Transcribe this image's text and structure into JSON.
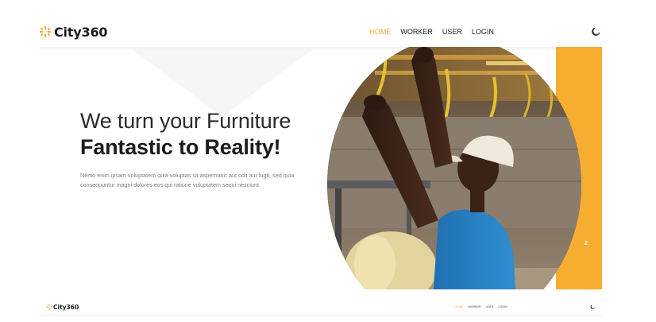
{
  "brand": {
    "name": "City360",
    "logo_icon": "sparkle-logo-icon",
    "accent": "#f2a93b"
  },
  "nav": {
    "items": [
      {
        "label": "HOME",
        "active": true
      },
      {
        "label": "WORKER",
        "active": false
      },
      {
        "label": "USER",
        "active": false
      },
      {
        "label": "LOGIN",
        "active": false
      }
    ],
    "theme_icon": "moon-icon"
  },
  "hero": {
    "title_light": "We turn your Furniture",
    "title_bold": "Fantastic to Reality!",
    "description": "Nemo enim ipsam voluptatem quia voluptas sit aspernatur aut odit aut fugit, sed quia consequuntur magni dolores eos qui ratione voluptatem sequi nesciunt",
    "slide_number": "2",
    "panel_color": "#f7ad2f"
  },
  "mini_nav": {
    "brand_name": "City360",
    "items": [
      {
        "label": "HOME",
        "active": true
      },
      {
        "label": "WORKER",
        "active": false
      },
      {
        "label": "USER",
        "active": false
      },
      {
        "label": "LOGIN",
        "active": false
      }
    ]
  }
}
